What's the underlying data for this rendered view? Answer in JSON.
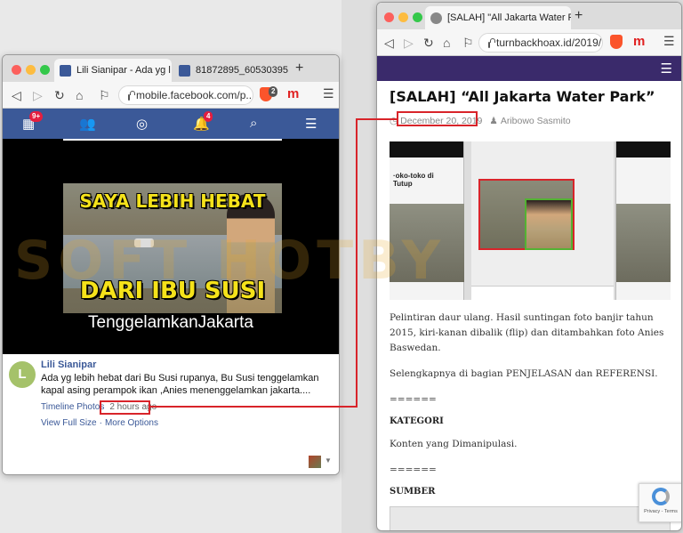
{
  "left_window": {
    "tabs": [
      {
        "label": "Lili Sianipar - Ada yg l",
        "active": true
      },
      {
        "label": "81872895_60530395",
        "active": false
      }
    ],
    "url": "mobile.facebook.com/p...",
    "brave_count": "2",
    "fb_nav": {
      "home_badge": "9+",
      "notifications_badge": "4"
    },
    "meme": {
      "line1": "SAYA LEBIH HEBAT",
      "line2": "DARI IBU SUSI",
      "caption": "TenggelamkanJakarta"
    },
    "post": {
      "author_initial": "L",
      "author": "Lili Sianipar",
      "text": "Ada yg lebih hebat dari Bu Susi rupanya, Bu Susi tenggelamkan kapal asing perampok ikan ,Anies menenggelamkan jakarta....",
      "album": "Timeline Photos",
      "time": "2 hours ago",
      "view_full": "View Full Size",
      "sep": "·",
      "more": "More Options"
    }
  },
  "right_window": {
    "tab_label": "[SALAH] \"All Jakarta Water Park\"",
    "url": "turnbackhoax.id/2019/1...",
    "article": {
      "title": "[SALAH] “All Jakarta Water Park”",
      "date": "December 20, 2019",
      "author": "Aribowo Sasmito",
      "p1": "Pelintiran daur ulang. Hasil suntingan foto banjir tahun 2015, kiri-kanan dibalik (flip) dan ditambahkan foto Anies Baswedan.",
      "p2": "Selengkapnya di bagian PENJELASAN dan REFERENSI.",
      "sep1": "======",
      "h_kategori": "KATEGORI",
      "kategori": "Konten yang Dimanipulasi.",
      "sep2": "======",
      "h_sumber": "SUMBER"
    },
    "recaptcha_text": "Privacy - Terms"
  },
  "watermark": "SOFT HOTBY",
  "colors": {
    "fb_blue": "#3b5998",
    "highlight_red": "#d8242a",
    "site_purple": "#3a2a6b"
  }
}
